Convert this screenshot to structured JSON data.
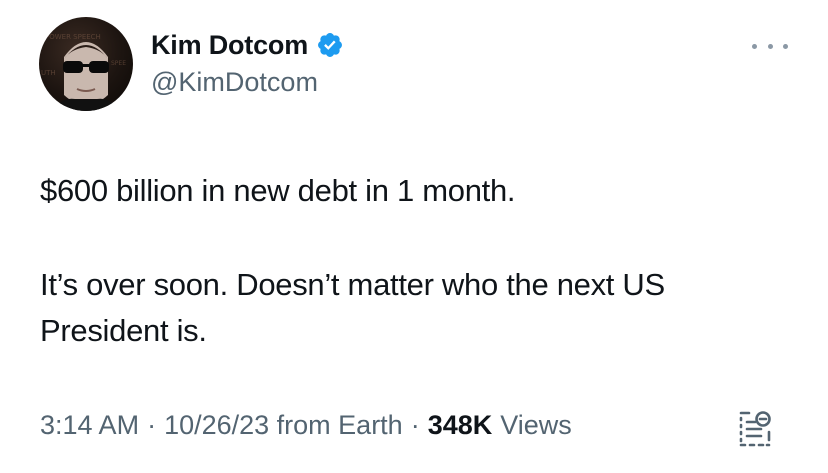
{
  "author": {
    "display_name": "Kim Dotcom",
    "handle": "@KimDotcom",
    "verified": true,
    "verified_icon": "verified-badge-icon",
    "avatar_icon": "avatar"
  },
  "more_icon": "more-dots-icon",
  "tweet": {
    "line1": "$600 billion in new debt in 1 month.",
    "line2": "It’s over soon. Doesn’t matter who the next US",
    "line3": "President is."
  },
  "meta": {
    "time": "3:14 AM",
    "date_source": "10/26/23 from Earth",
    "views_count": "348K",
    "views_label": "Views",
    "separator": "·"
  },
  "colors": {
    "text_primary": "#0f1419",
    "text_secondary": "#536471",
    "verified_blue": "#1d9bf0"
  }
}
